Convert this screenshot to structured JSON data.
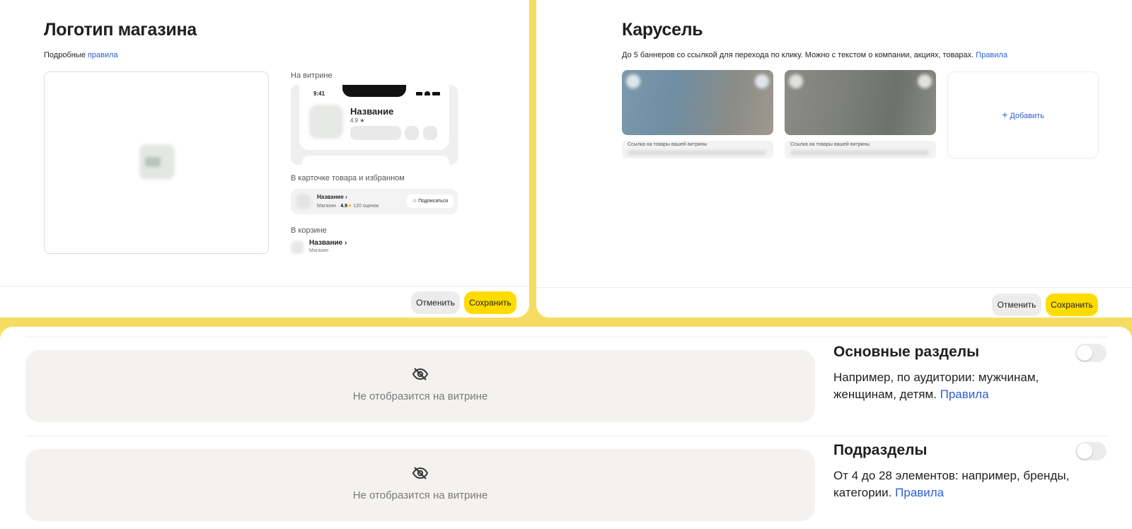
{
  "logo_panel": {
    "title": "Логотип магазина",
    "rules_prefix": "Подробные",
    "rules_link": "правила",
    "on_showcase_label": "На витрине",
    "phone_time": "9:41",
    "phone_name": "Название",
    "phone_rating": "4.9 ★",
    "card_label": "В карточке товара и избранном",
    "card_name": "Название",
    "card_shop": "Магазин ·",
    "card_rating": "4.9",
    "card_reviews": "120 оценок",
    "subscribe_label": "Подписаться",
    "cart_label": "В корзине",
    "cart_name": "Название",
    "cart_shop": "Магазин",
    "cancel_label": "Отменить",
    "save_label": "Сохранить"
  },
  "carousel_panel": {
    "title": "Карусель",
    "description": "До 5 баннеров со ссылкой для перехода по клику. Можно с текстом о компании, акциях, товарах.",
    "rules_link": "Правила",
    "banners": [
      {
        "link_label": "Ссылка на товары вашей витрины"
      },
      {
        "link_label": "Ссылка на товары вашей витрины"
      }
    ],
    "add_label": "Добавить",
    "cancel_label": "Отменить",
    "save_label": "Сохранить"
  },
  "sections_panel": {
    "rows": [
      {
        "placeholder": "Не отобразится на витрине",
        "title": "Основные разделы",
        "description": "Например, по аудитории: мужчинам, женщинам, детям.",
        "rules_link": "Правила",
        "enabled": false
      },
      {
        "placeholder": "Не отобразится на витрине",
        "title": "Подразделы",
        "description": "От 4 до 28 элементов: например, бренды, категории.",
        "rules_link": "Правила",
        "enabled": false
      }
    ]
  },
  "icons": {
    "hidden": "eye-off-icon",
    "star": "star-icon",
    "chevron": "chevron-right-icon",
    "plus": "plus-icon",
    "close": "close-icon"
  },
  "colors": {
    "accent_yellow": "#ffdc00",
    "background_yellow": "#f6dc62",
    "link_blue": "#2c5fd6"
  }
}
